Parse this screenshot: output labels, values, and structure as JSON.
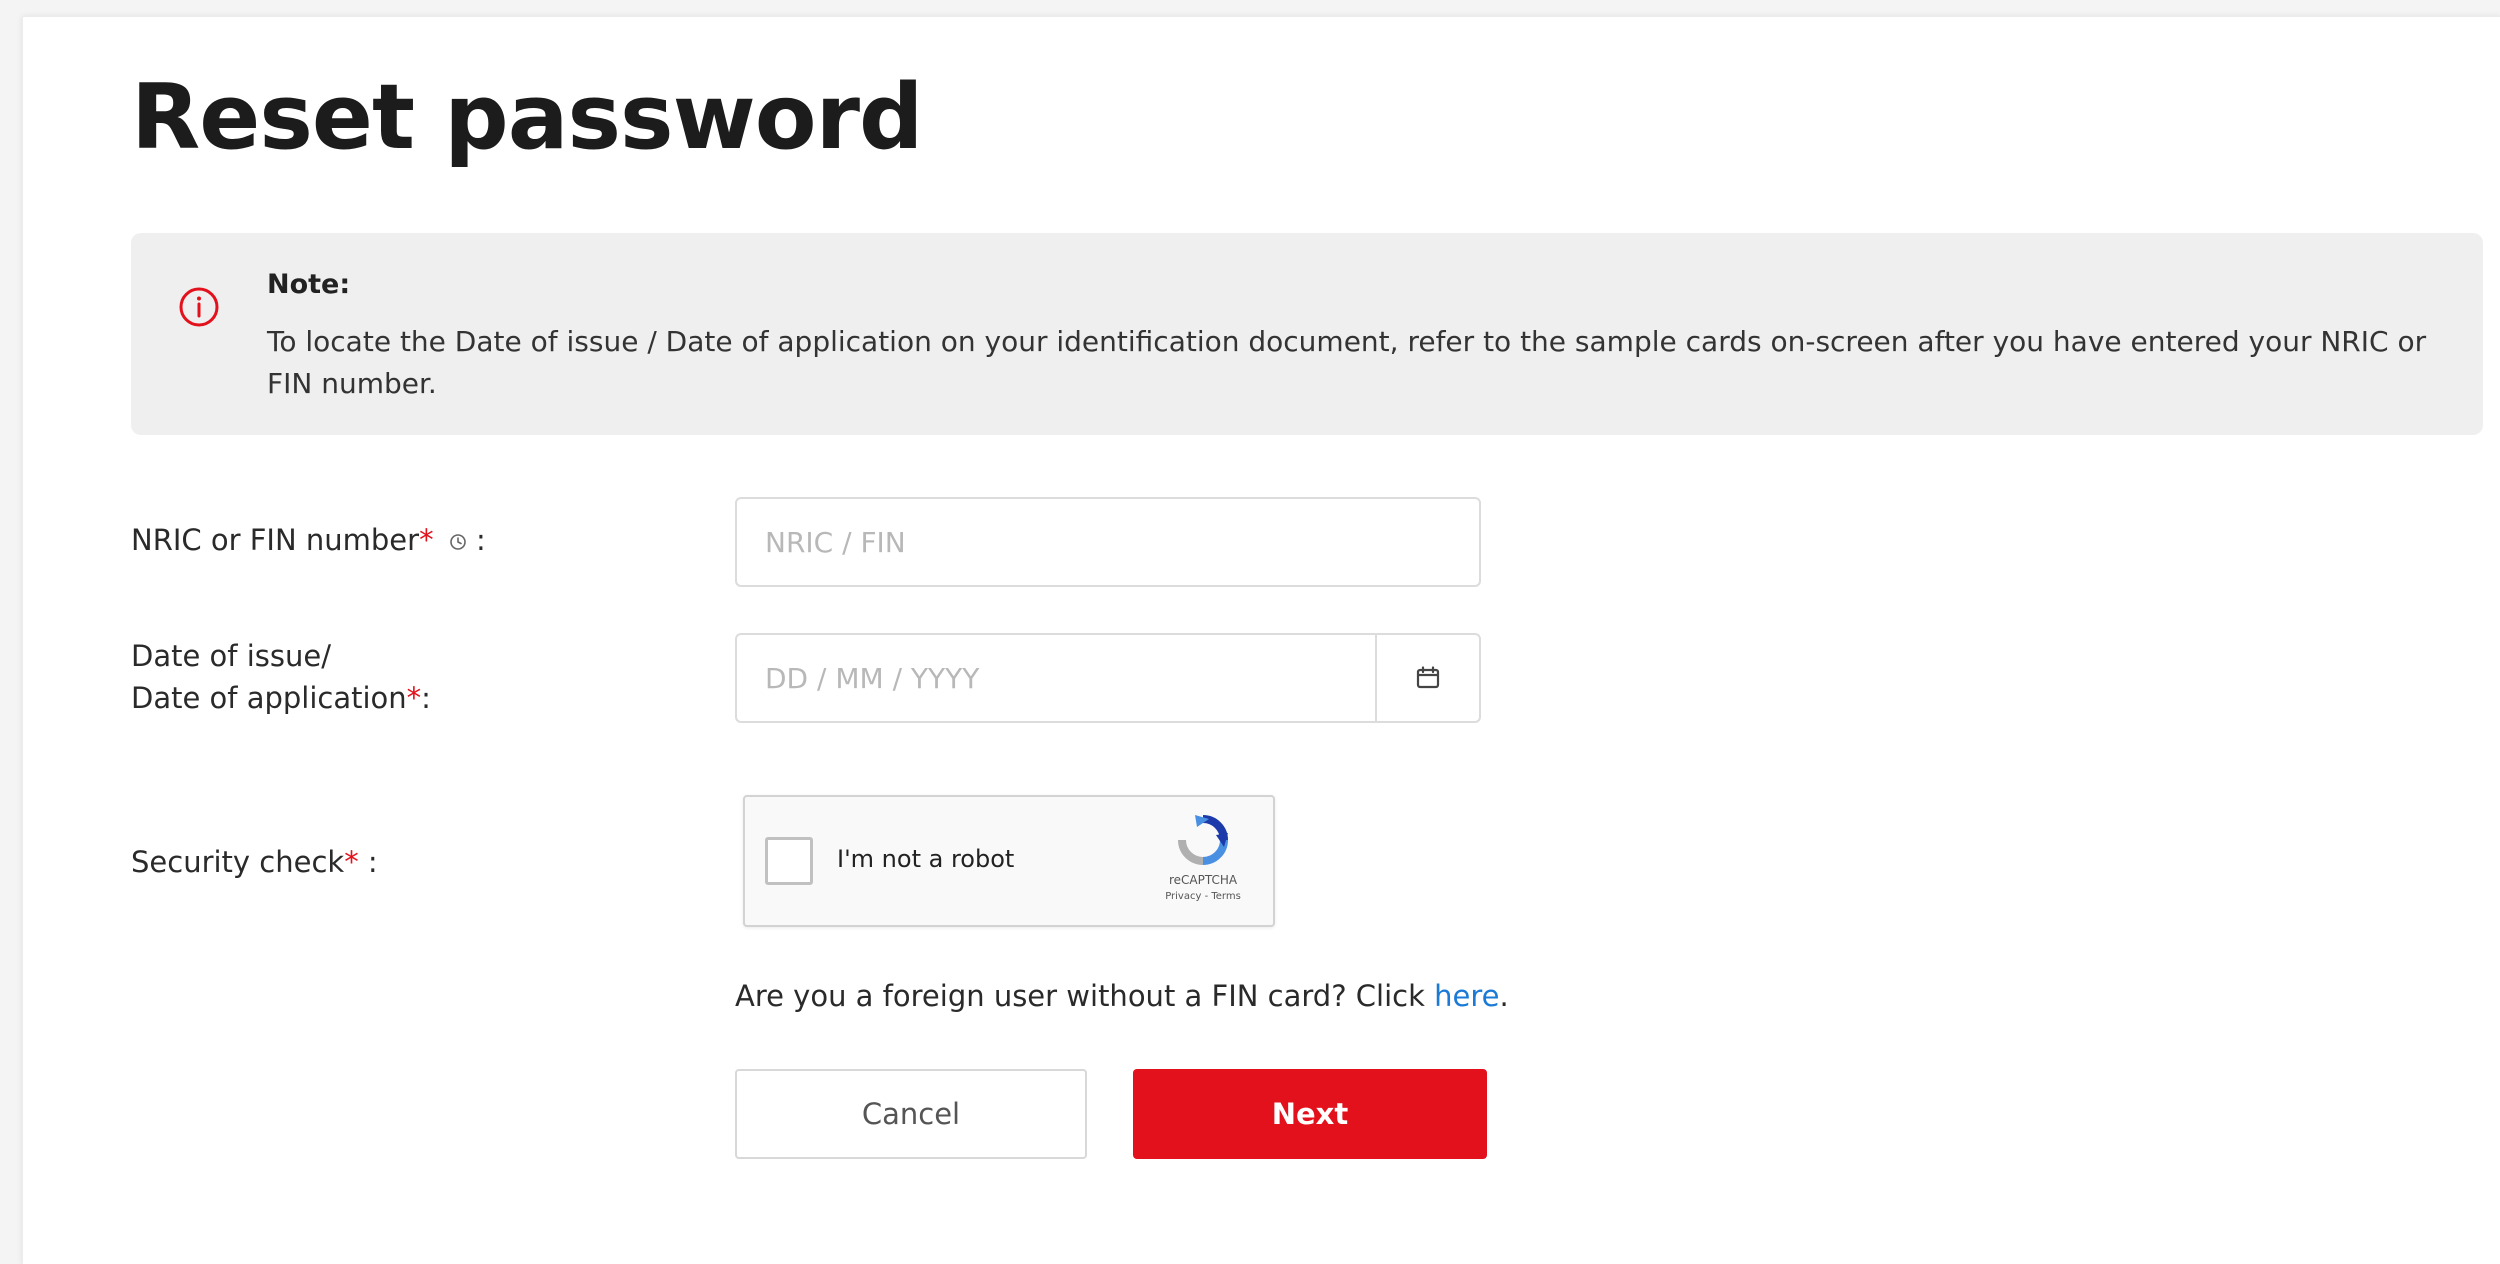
{
  "page": {
    "title": "Reset password"
  },
  "note": {
    "icon": "info-circle-icon",
    "title": "Note:",
    "text": "To locate the Date of issue / Date of application on your identification document, refer to the sample cards on-screen after you have entered your NRIC or FIN number."
  },
  "form": {
    "nric": {
      "label": "NRIC or FIN number",
      "required_mark": "*",
      "help_icon": "help-clock-icon",
      "colon": " :",
      "placeholder": "NRIC / FIN",
      "value": ""
    },
    "date": {
      "label_line1": "Date of issue/",
      "label_line2": "Date of application",
      "required_mark": "*",
      "colon": ":",
      "placeholder": "DD / MM / YYYY",
      "value": "",
      "calendar_icon": "calendar-icon"
    },
    "security": {
      "label": "Security check",
      "required_mark": "*",
      "colon": " :",
      "recaptcha_label": "I'm not a robot",
      "recaptcha_brand": "reCAPTCHA",
      "recaptcha_links": "Privacy - Terms"
    },
    "foreign": {
      "text": "Are you a foreign user without a FIN card? Click ",
      "link_text": "here",
      "suffix": "."
    },
    "buttons": {
      "cancel": "Cancel",
      "next": "Next"
    }
  },
  "colors": {
    "accent": "#e3111c",
    "link": "#1a7ad6",
    "note_bg": "#efefef"
  }
}
